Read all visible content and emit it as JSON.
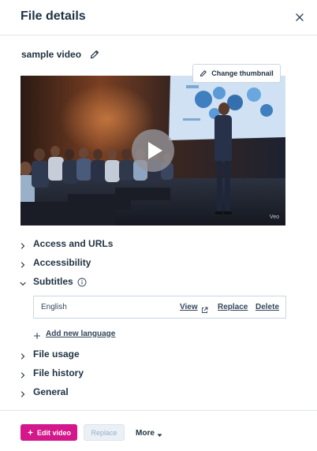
{
  "header": {
    "title": "File details"
  },
  "file": {
    "name": "sample video"
  },
  "video": {
    "watermark": "Veo"
  },
  "thumbnail": {
    "label": "Change thumbnail"
  },
  "sections": [
    {
      "label": "Access and URLs",
      "expanded": false
    },
    {
      "label": "Accessibility",
      "expanded": false
    },
    {
      "label": "Subtitles",
      "expanded": true
    },
    {
      "label": "File usage",
      "expanded": false
    },
    {
      "label": "File history",
      "expanded": false
    },
    {
      "label": "General",
      "expanded": false
    }
  ],
  "subtitles": {
    "rows": [
      {
        "language": "English",
        "view": "View",
        "replace": "Replace",
        "delete": "Delete"
      }
    ],
    "add_label": "Add new language"
  },
  "footer": {
    "edit_label": "Edit video",
    "replace_label": "Replace",
    "more_label": "More"
  },
  "colors": {
    "primary_text": "#213343",
    "accent_pink": "#d4178a",
    "link": "#33475b",
    "divider": "#dfe3eb"
  },
  "icons": [
    "close-icon",
    "pencil-icon",
    "play-icon",
    "chevron-right-icon",
    "chevron-down-icon",
    "info-icon",
    "external-link-icon",
    "plus-icon",
    "sparkle-icon",
    "caret-down-icon"
  ]
}
